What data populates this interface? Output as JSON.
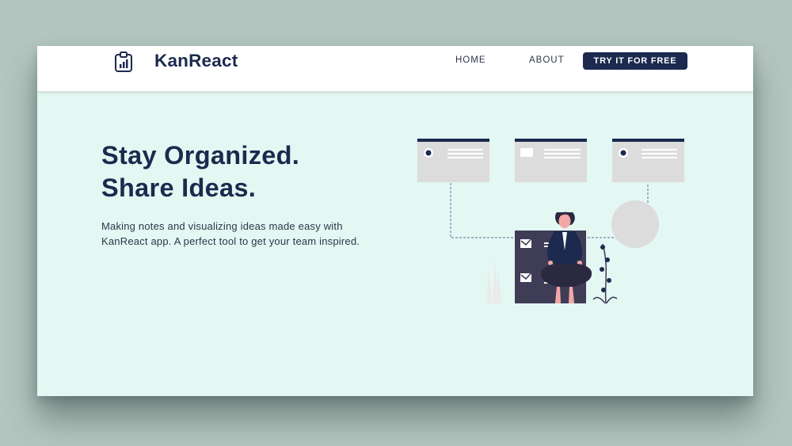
{
  "brand": {
    "name": "KanReact",
    "logo_icon": "clipboard-chart-icon"
  },
  "nav": {
    "items": [
      {
        "label": "HOME"
      },
      {
        "label": "ABOUT"
      }
    ],
    "cta_label": "TRY IT FOR FREE"
  },
  "hero": {
    "headline_line1": "Stay Organized.",
    "headline_line2": "Share Ideas.",
    "description": "Making notes and visualizing ideas made easy with KanReact app. A perfect tool to get your team inspired."
  },
  "illustration": {
    "name": "woman-sitting-on-task-board-illustration"
  },
  "colors": {
    "primary": "#1b2a4e",
    "hero_background": "#e3f7f3",
    "navbar_background": "#ffffff",
    "page_background": "#b5c6c1",
    "board_dark": "#3f3d56",
    "card_gray": "#dcdcdc",
    "accent_pink": "#f2a7a7"
  }
}
